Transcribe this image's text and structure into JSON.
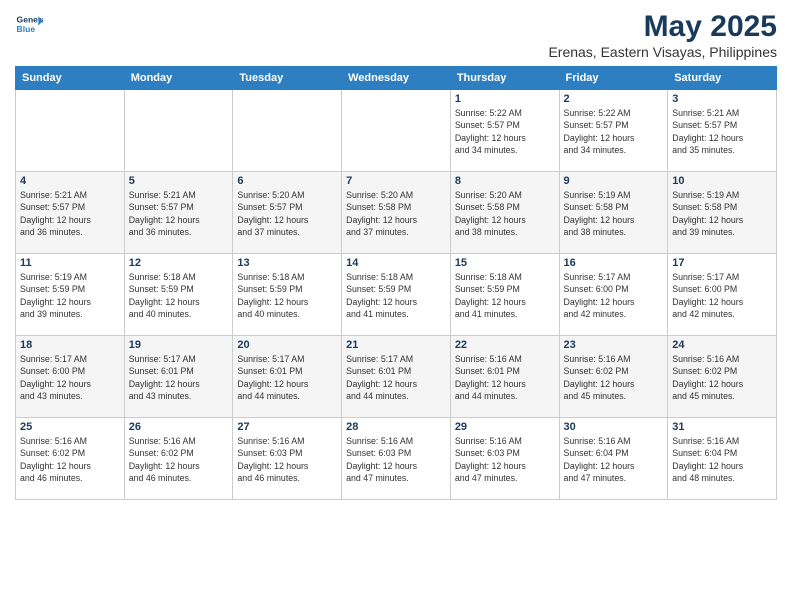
{
  "header": {
    "logo_line1": "General",
    "logo_line2": "Blue",
    "title": "May 2025",
    "subtitle": "Erenas, Eastern Visayas, Philippines"
  },
  "days_of_week": [
    "Sunday",
    "Monday",
    "Tuesday",
    "Wednesday",
    "Thursday",
    "Friday",
    "Saturday"
  ],
  "weeks": [
    [
      {
        "day": "",
        "info": ""
      },
      {
        "day": "",
        "info": ""
      },
      {
        "day": "",
        "info": ""
      },
      {
        "day": "",
        "info": ""
      },
      {
        "day": "1",
        "info": "Sunrise: 5:22 AM\nSunset: 5:57 PM\nDaylight: 12 hours\nand 34 minutes."
      },
      {
        "day": "2",
        "info": "Sunrise: 5:22 AM\nSunset: 5:57 PM\nDaylight: 12 hours\nand 34 minutes."
      },
      {
        "day": "3",
        "info": "Sunrise: 5:21 AM\nSunset: 5:57 PM\nDaylight: 12 hours\nand 35 minutes."
      }
    ],
    [
      {
        "day": "4",
        "info": "Sunrise: 5:21 AM\nSunset: 5:57 PM\nDaylight: 12 hours\nand 36 minutes."
      },
      {
        "day": "5",
        "info": "Sunrise: 5:21 AM\nSunset: 5:57 PM\nDaylight: 12 hours\nand 36 minutes."
      },
      {
        "day": "6",
        "info": "Sunrise: 5:20 AM\nSunset: 5:57 PM\nDaylight: 12 hours\nand 37 minutes."
      },
      {
        "day": "7",
        "info": "Sunrise: 5:20 AM\nSunset: 5:58 PM\nDaylight: 12 hours\nand 37 minutes."
      },
      {
        "day": "8",
        "info": "Sunrise: 5:20 AM\nSunset: 5:58 PM\nDaylight: 12 hours\nand 38 minutes."
      },
      {
        "day": "9",
        "info": "Sunrise: 5:19 AM\nSunset: 5:58 PM\nDaylight: 12 hours\nand 38 minutes."
      },
      {
        "day": "10",
        "info": "Sunrise: 5:19 AM\nSunset: 5:58 PM\nDaylight: 12 hours\nand 39 minutes."
      }
    ],
    [
      {
        "day": "11",
        "info": "Sunrise: 5:19 AM\nSunset: 5:59 PM\nDaylight: 12 hours\nand 39 minutes."
      },
      {
        "day": "12",
        "info": "Sunrise: 5:18 AM\nSunset: 5:59 PM\nDaylight: 12 hours\nand 40 minutes."
      },
      {
        "day": "13",
        "info": "Sunrise: 5:18 AM\nSunset: 5:59 PM\nDaylight: 12 hours\nand 40 minutes."
      },
      {
        "day": "14",
        "info": "Sunrise: 5:18 AM\nSunset: 5:59 PM\nDaylight: 12 hours\nand 41 minutes."
      },
      {
        "day": "15",
        "info": "Sunrise: 5:18 AM\nSunset: 5:59 PM\nDaylight: 12 hours\nand 41 minutes."
      },
      {
        "day": "16",
        "info": "Sunrise: 5:17 AM\nSunset: 6:00 PM\nDaylight: 12 hours\nand 42 minutes."
      },
      {
        "day": "17",
        "info": "Sunrise: 5:17 AM\nSunset: 6:00 PM\nDaylight: 12 hours\nand 42 minutes."
      }
    ],
    [
      {
        "day": "18",
        "info": "Sunrise: 5:17 AM\nSunset: 6:00 PM\nDaylight: 12 hours\nand 43 minutes."
      },
      {
        "day": "19",
        "info": "Sunrise: 5:17 AM\nSunset: 6:01 PM\nDaylight: 12 hours\nand 43 minutes."
      },
      {
        "day": "20",
        "info": "Sunrise: 5:17 AM\nSunset: 6:01 PM\nDaylight: 12 hours\nand 44 minutes."
      },
      {
        "day": "21",
        "info": "Sunrise: 5:17 AM\nSunset: 6:01 PM\nDaylight: 12 hours\nand 44 minutes."
      },
      {
        "day": "22",
        "info": "Sunrise: 5:16 AM\nSunset: 6:01 PM\nDaylight: 12 hours\nand 44 minutes."
      },
      {
        "day": "23",
        "info": "Sunrise: 5:16 AM\nSunset: 6:02 PM\nDaylight: 12 hours\nand 45 minutes."
      },
      {
        "day": "24",
        "info": "Sunrise: 5:16 AM\nSunset: 6:02 PM\nDaylight: 12 hours\nand 45 minutes."
      }
    ],
    [
      {
        "day": "25",
        "info": "Sunrise: 5:16 AM\nSunset: 6:02 PM\nDaylight: 12 hours\nand 46 minutes."
      },
      {
        "day": "26",
        "info": "Sunrise: 5:16 AM\nSunset: 6:02 PM\nDaylight: 12 hours\nand 46 minutes."
      },
      {
        "day": "27",
        "info": "Sunrise: 5:16 AM\nSunset: 6:03 PM\nDaylight: 12 hours\nand 46 minutes."
      },
      {
        "day": "28",
        "info": "Sunrise: 5:16 AM\nSunset: 6:03 PM\nDaylight: 12 hours\nand 47 minutes."
      },
      {
        "day": "29",
        "info": "Sunrise: 5:16 AM\nSunset: 6:03 PM\nDaylight: 12 hours\nand 47 minutes."
      },
      {
        "day": "30",
        "info": "Sunrise: 5:16 AM\nSunset: 6:04 PM\nDaylight: 12 hours\nand 47 minutes."
      },
      {
        "day": "31",
        "info": "Sunrise: 5:16 AM\nSunset: 6:04 PM\nDaylight: 12 hours\nand 48 minutes."
      }
    ]
  ]
}
